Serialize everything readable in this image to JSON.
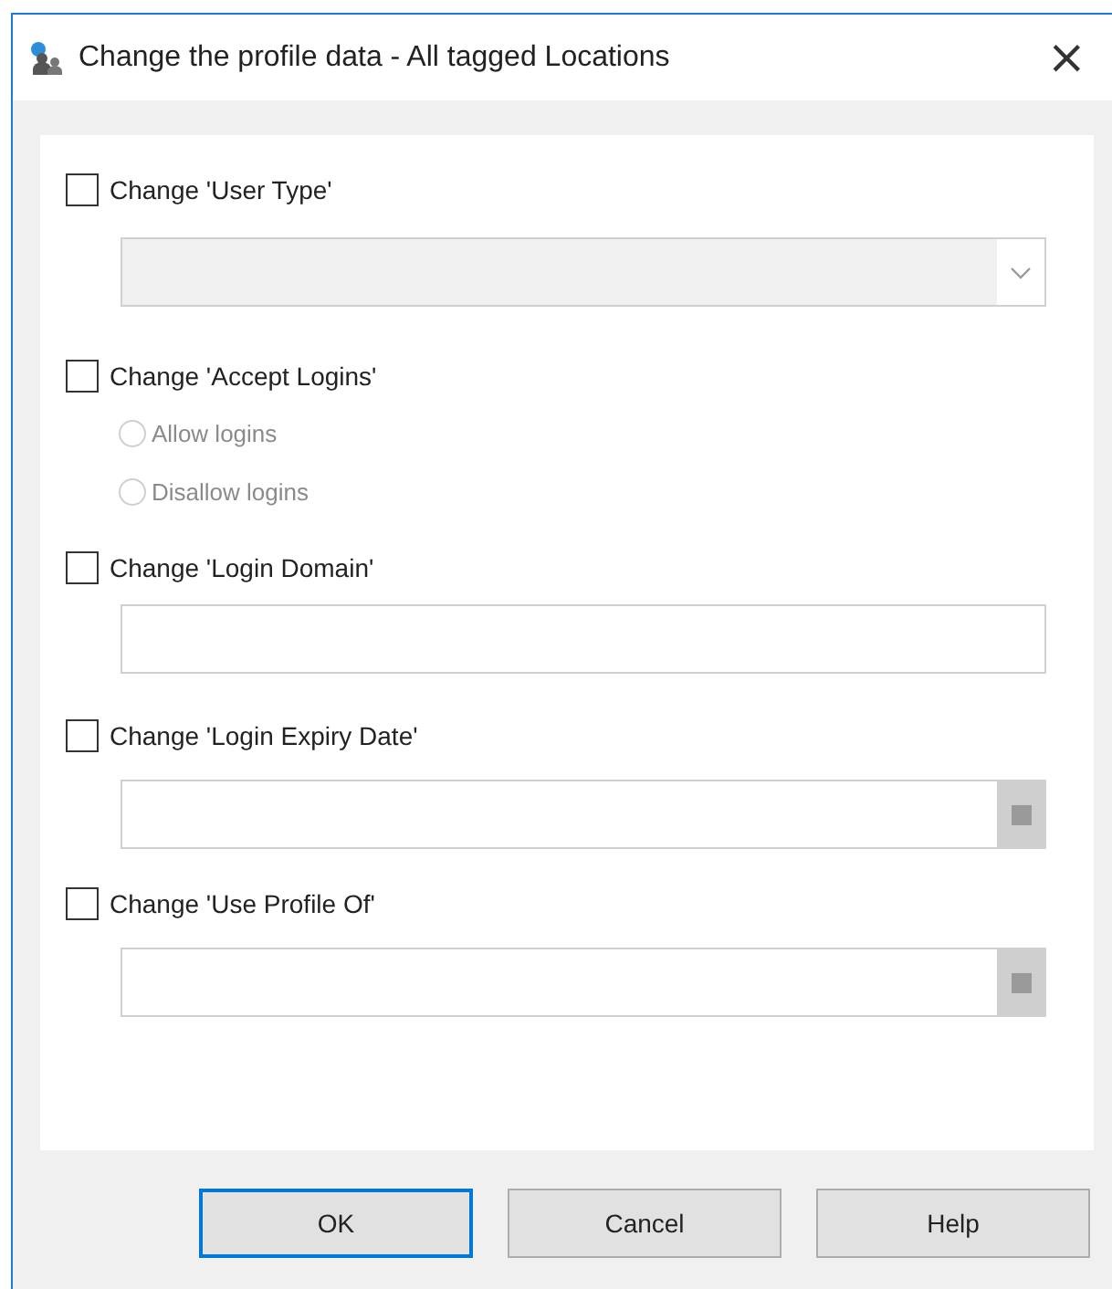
{
  "window": {
    "title": "Change the profile data - All tagged Locations",
    "close": "×"
  },
  "sections": [
    {
      "kind": "combo",
      "label": "Change 'User Type'",
      "checked": false,
      "disabled": true
    },
    {
      "kind": "radios",
      "label": "Change 'Accept Logins'",
      "checked": false,
      "options": [
        {
          "label": "Allow logins",
          "selected": false,
          "disabled": true
        },
        {
          "label": "Disallow logins",
          "selected": false,
          "disabled": true
        }
      ]
    },
    {
      "kind": "text",
      "label": "Change 'Login Domain'",
      "checked": false
    },
    {
      "kind": "picker",
      "label": "Change 'Login Expiry Date'",
      "checked": false
    },
    {
      "kind": "picker",
      "label": "Change 'Use Profile Of'",
      "checked": false
    }
  ],
  "buttons": [
    {
      "label": "OK",
      "default": true
    },
    {
      "label": "Cancel",
      "default": false
    },
    {
      "label": "Help",
      "default": false
    }
  ]
}
